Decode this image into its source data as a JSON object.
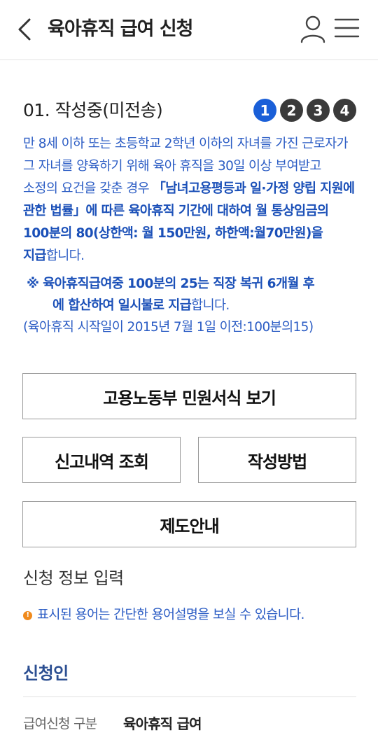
{
  "header": {
    "title": "육아휴직 급여 신청"
  },
  "status": {
    "title": "01. 작성중(미전송)",
    "steps": [
      "1",
      "2",
      "3",
      "4"
    ],
    "active_step": 1
  },
  "description": {
    "part1": "만 8세 이하 또는 초등학교 2학년 이하의 자녀를 가진 근로자가 그 자녀를 양육하기 위해 육아 휴직을 30일 이상 부여받고 소정의 요건을 갖춘 경우 ",
    "bold": "「남녀고용평등과 일·가정 양립 지원에 관한 법률」에 따른 육아휴직 기간에 대하여 월 통상임금의 100분의 80(상한액: 월 150만원, 하한액:월70만원)을 지급",
    "part2": "합니다."
  },
  "note": {
    "bold1": "※ 육아휴직급여중 100분의 25는 직장 복귀 6개월 후",
    "bold2": "에 합산하여 일시불로 지급",
    "rest2": "합니다.",
    "line3": "(육아휴직 시작일이 2015년 7월 1일 이전:100분의15)"
  },
  "buttons": {
    "form_view": "고용노동부 민원서식 보기",
    "history": "신고내역 조회",
    "howto": "작성방법",
    "guide": "제도안내"
  },
  "input_section": {
    "title": "신청 정보 입력",
    "hint": "표시된 용어는 간단한 용어설명을 보실 수 있습니다."
  },
  "applicant": {
    "title": "신청인",
    "field_label": "급여신청 구분",
    "field_value": "육아휴직 급여"
  },
  "colors": {
    "accent_blue": "#1a5fd8",
    "text_blue": "#2b5cc4",
    "section_navy": "#2c4f92",
    "hint_orange": "#f08a1c"
  }
}
